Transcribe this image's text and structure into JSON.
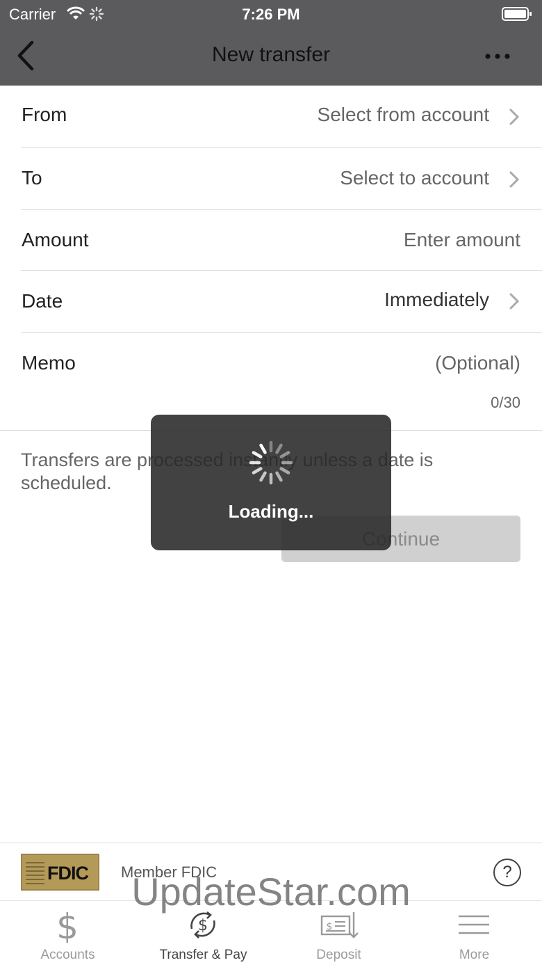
{
  "status_bar": {
    "carrier": "Carrier",
    "time": "7:26 PM"
  },
  "nav": {
    "title": "New transfer"
  },
  "form": {
    "from": {
      "label": "From",
      "value": "Select from account"
    },
    "to": {
      "label": "To",
      "value": "Select to account"
    },
    "amount": {
      "label": "Amount",
      "placeholder": "Enter amount"
    },
    "date": {
      "label": "Date",
      "value": "Immediately"
    },
    "memo": {
      "label": "Memo",
      "placeholder": "(Optional)",
      "counter": "0/30"
    }
  },
  "note": "Transfers are processed instantly unless a date is scheduled.",
  "continue_label": "Continue",
  "loading_label": "Loading...",
  "member": {
    "text": "Member FDIC",
    "logo_text": "FDIC",
    "help": "?"
  },
  "tabs": [
    {
      "label": "Accounts",
      "icon": "dollar-icon"
    },
    {
      "label": "Transfer & Pay",
      "icon": "transfer-pay-icon"
    },
    {
      "label": "Deposit",
      "icon": "check-deposit-icon"
    },
    {
      "label": "More",
      "icon": "menu-icon"
    }
  ],
  "watermark": "UpdateStar.com",
  "colors": {
    "header": "#5b5b5e",
    "button_disabled": "#d0d0d0",
    "overlay": "#282828",
    "fdic_gold": "#b49a59"
  }
}
